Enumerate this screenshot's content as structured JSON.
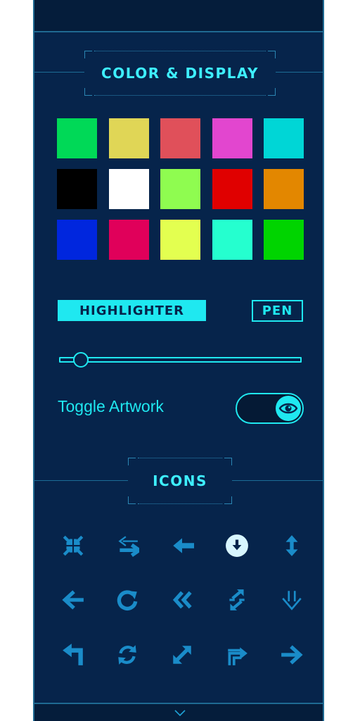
{
  "panel": {
    "color_section_title": "COLOR & DISPLAY",
    "icons_section_title": "ICONS"
  },
  "palette": [
    "#00d957",
    "#e0d656",
    "#e0505a",
    "#e246cf",
    "#00d6d6",
    "#000000",
    "#ffffff",
    "#8ffc50",
    "#e00000",
    "#e38700",
    "#0026de",
    "#e0005a",
    "#e3ff50",
    "#25ffcf",
    "#00d400"
  ],
  "tools": {
    "highlighter_label": "HIGHLIGHTER",
    "pen_label": "PEN",
    "active_tool": "highlighter"
  },
  "brush_size": {
    "level_fraction": 0.03
  },
  "toggle_artwork": {
    "label": "Toggle Artwork",
    "state": "on",
    "icon": "eye-icon"
  },
  "icons": [
    "compress-arrows-icon",
    "swap-arrows-icon",
    "arrow-left-bold-icon",
    "download-circle-icon",
    "arrows-vertical-icon",
    "arrow-left-icon",
    "redo-icon",
    "double-chevron-left-icon",
    "arrows-diagonal-swap-icon",
    "arrow-down-curved-icon",
    "turn-left-icon",
    "sync-icon",
    "expand-diagonal-icon",
    "turn-up-right-icon",
    "arrow-right-icon"
  ],
  "colors": {
    "panel_bg": "#06244b",
    "accent": "#1fe8f0",
    "icon": "#1a8cc9",
    "border": "#1f6a92"
  }
}
